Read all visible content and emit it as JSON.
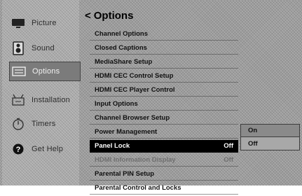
{
  "sidebar": {
    "items": [
      {
        "label": "Picture",
        "icon": "tv-icon"
      },
      {
        "label": "Sound",
        "icon": "speaker-icon"
      },
      {
        "label": "Options",
        "icon": "options-icon",
        "selected": true
      },
      {
        "label": "Installation",
        "icon": "installation-icon"
      },
      {
        "label": "Timers",
        "icon": "timer-icon"
      },
      {
        "label": "Get Help",
        "icon": "help-icon"
      }
    ]
  },
  "main": {
    "back_glyph": "<",
    "title": "Options",
    "menu": [
      {
        "label": "Channel Options"
      },
      {
        "label": "Closed Captions"
      },
      {
        "label": "MediaShare Setup"
      },
      {
        "label": "HDMI CEC Control Setup"
      },
      {
        "label": "HDMI CEC Player Control"
      },
      {
        "label": "Input Options"
      },
      {
        "label": "Channel Browser Setup"
      },
      {
        "label": "Power Management"
      },
      {
        "label": "Panel Lock",
        "value": "Off",
        "active": true
      },
      {
        "label": "HDMI Information Display",
        "value": "Off",
        "disabled": true
      },
      {
        "label": "Parental PIN Setup"
      },
      {
        "label": "Parental Control and Locks"
      }
    ]
  },
  "submenu": {
    "options": [
      "On",
      "Off"
    ]
  }
}
